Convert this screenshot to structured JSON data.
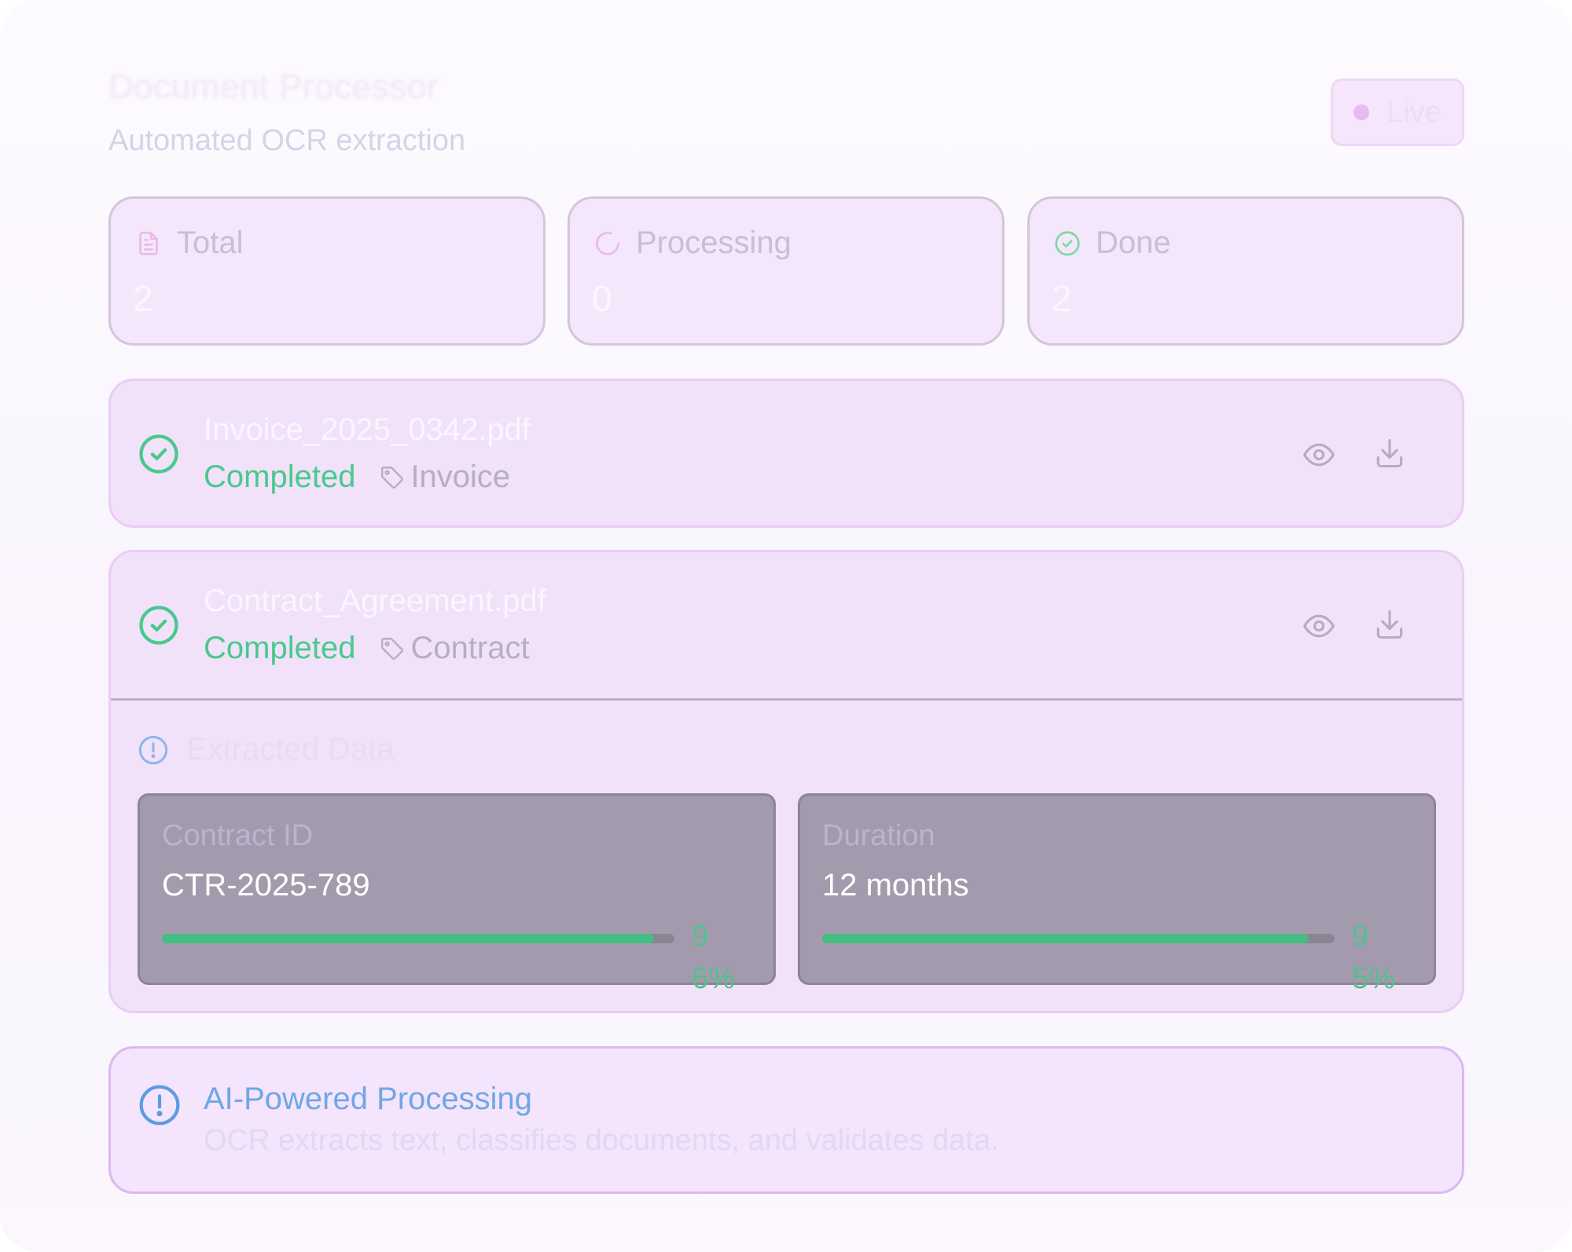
{
  "header": {
    "title": "Document Processor",
    "subtitle": "Automated OCR extraction",
    "live_label": "Live"
  },
  "stats": [
    {
      "label": "Total",
      "value": "2",
      "icon": "document-icon"
    },
    {
      "label": "Processing",
      "value": "0",
      "icon": "spinner-icon"
    },
    {
      "label": "Done",
      "value": "2",
      "icon": "check-circle-icon"
    }
  ],
  "documents": [
    {
      "name": "Invoice_2025_0342.pdf",
      "status": "Completed",
      "tag": "Invoice"
    },
    {
      "name": "Contract_Agreement.pdf",
      "status": "Completed",
      "tag": "Contract"
    }
  ],
  "extracted": {
    "title": "Extracted Data",
    "fields": [
      {
        "label": "Contract ID",
        "value": "CTR-2025-789",
        "confidence": 96,
        "confidence_label": "96%"
      },
      {
        "label": "Duration",
        "value": "12 months",
        "confidence": 95,
        "confidence_label": "95%"
      }
    ]
  },
  "info": {
    "title": "AI-Powered Processing",
    "description": "OCR extracts text, classifies documents, and validates data."
  },
  "colors": {
    "success": "#49c98d",
    "info": "#70a7e6",
    "card_bg": "#f1e1f9",
    "field_bg": "#a39bad"
  }
}
